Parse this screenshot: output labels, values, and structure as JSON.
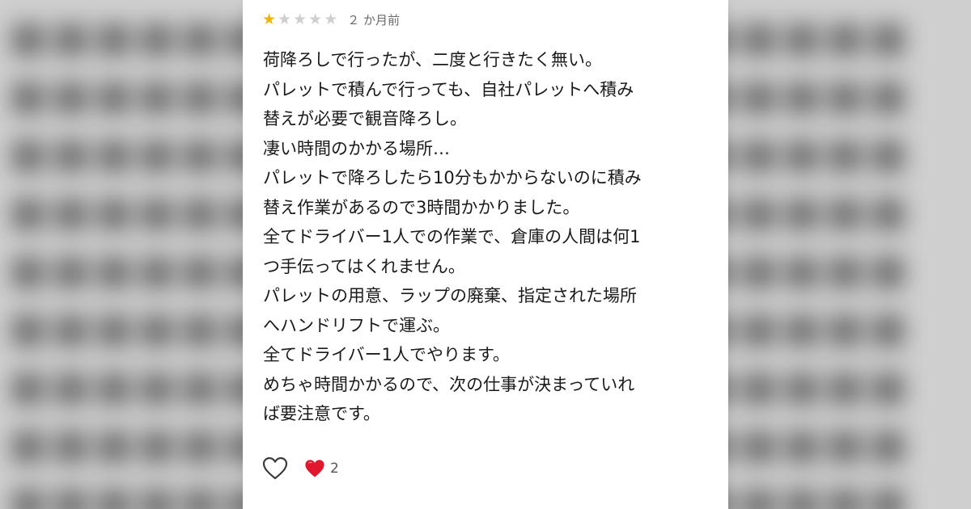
{
  "review": {
    "rating": 1,
    "max_rating": 5,
    "timestamp": "２ か月前",
    "lines": [
      "荷降ろしで行ったが、二度と行きたく無い。",
      "パレットで積んで行っても、自社パレットへ積み",
      "替えが必要で観音降ろし。",
      "凄い時間のかかる場所…",
      "パレットで降ろしたら10分もかからないのに積み",
      "替え作業があるので3時間かかりました。",
      "全てドライバー1人での作業で、倉庫の人間は何1",
      "つ手伝ってはくれません。",
      "パレットの用意、ラップの廃棄、指定された場所",
      "へハンドリフトで運ぶ。",
      "全てドライバー1人でやります。",
      "めちゃ時間かかるので、次の仕事が決まっていれ",
      "ば要注意です。"
    ]
  },
  "actions": {
    "like_icon": "heart-outline-icon",
    "reaction_icon": "red-heart-icon",
    "reaction_count": "2"
  },
  "colors": {
    "star_filled": "#f1b400",
    "star_empty": "#cfcfcf",
    "heart_red": "#e0182d",
    "background_gray": "#cfcfcf"
  }
}
